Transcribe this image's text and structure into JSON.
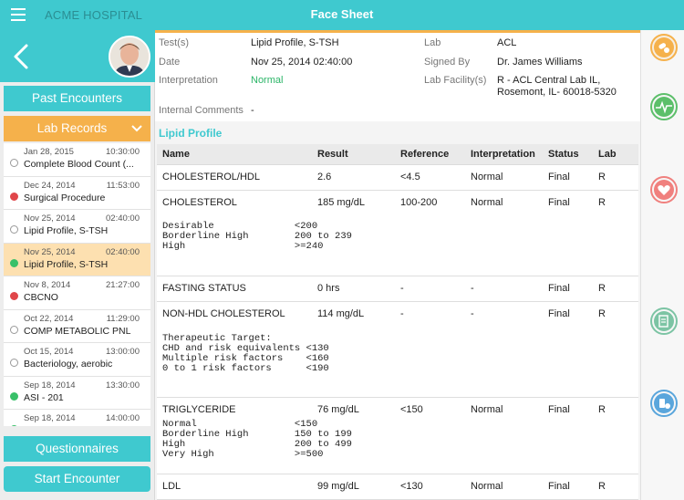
{
  "header": {
    "hospital": "ACME HOSPITAL",
    "title": "Face Sheet"
  },
  "sidebar": {
    "past_encounters": "Past Encounters",
    "lab_records": "Lab Records",
    "questionnaires": "Questionnaires",
    "start_encounter": "Start Encounter",
    "records": [
      {
        "date": "Jan 28, 2015",
        "time": "10:30:00",
        "name": "Complete Blood Count (...",
        "status": "none"
      },
      {
        "date": "Dec 24, 2014",
        "time": "11:53:00",
        "name": "Surgical Procedure",
        "status": "red"
      },
      {
        "date": "Nov 25, 2014",
        "time": "02:40:00",
        "name": "Lipid Profile, S-TSH",
        "status": "none"
      },
      {
        "date": "Nov 25, 2014",
        "time": "02:40:00",
        "name": "Lipid Profile, S-TSH",
        "status": "green"
      },
      {
        "date": "Nov 8, 2014",
        "time": "21:27:00",
        "name": "CBCNO",
        "status": "red"
      },
      {
        "date": "Oct 22, 2014",
        "time": "11:29:00",
        "name": "COMP METABOLIC PNL",
        "status": "none"
      },
      {
        "date": "Oct 15, 2014",
        "time": "13:00:00",
        "name": "Bacteriology, aerobic",
        "status": "none"
      },
      {
        "date": "Sep 18, 2014",
        "time": "13:30:00",
        "name": "ASI - 201",
        "status": "green"
      },
      {
        "date": "Sep 18, 2014",
        "time": "14:00:00",
        "name": "",
        "status": "green"
      }
    ]
  },
  "info": {
    "tests_label": "Test(s)",
    "tests_value": "Lipid Profile, S-TSH",
    "date_label": "Date",
    "date_value": "Nov 25, 2014 02:40:00",
    "interp_label": "Interpretation",
    "interp_value": "Normal",
    "lab_label": "Lab",
    "lab_value": "ACL",
    "signed_label": "Signed By",
    "signed_value": "Dr. James Williams",
    "facility_label": "Lab Facility(s)",
    "facility_line1": "R - ACL Central Lab IL,",
    "facility_line2": "Rosemont, IL- 60018-5320",
    "comments_label": "Internal Comments",
    "comments_value": "-"
  },
  "section_title": "Lipid Profile",
  "table": {
    "headers": {
      "name": "Name",
      "result": "Result",
      "reference": "Reference",
      "interpretation": "Interpretation",
      "status": "Status",
      "lab": "Lab"
    },
    "rows": [
      {
        "name": "CHOLESTEROL/HDL",
        "result": "2.6",
        "reference": "<4.5",
        "interpretation": "Normal",
        "status": "Final",
        "lab": "R",
        "note": ""
      },
      {
        "name": "CHOLESTEROL",
        "result": "185 mg/dL",
        "reference": "100-200",
        "interpretation": "Normal",
        "status": "Final",
        "lab": "R",
        "note": "Desirable              <200\nBorderline High        200 to 239\nHigh                   >=240"
      },
      {
        "name": "FASTING STATUS",
        "result": "0 hrs",
        "reference": "-",
        "interpretation": "-",
        "status": "Final",
        "lab": "R",
        "note": ""
      },
      {
        "name": "NON-HDL CHOLESTEROL",
        "result": "114 mg/dL",
        "reference": "-",
        "interpretation": "-",
        "status": "Final",
        "lab": "R",
        "note": "Therapeutic Target:\nCHD and risk equivalents <130\nMultiple risk factors    <160\n0 to 1 risk factors      <190"
      },
      {
        "name": "TRIGLYCERIDE",
        "result": "76 mg/dL",
        "reference": "<150",
        "interpretation": "Normal",
        "status": "Final",
        "lab": "R",
        "note": "Normal                 <150\nBorderline High        150 to 199\nHigh                   200 to 499\nVery High              >=500"
      },
      {
        "name": "LDL",
        "result": "99 mg/dL",
        "reference": "<130",
        "interpretation": "Normal",
        "status": "Final",
        "lab": "R",
        "note": ""
      }
    ]
  },
  "rail": {
    "icons": [
      "pills-icon",
      "vitals-icon",
      "heart-icon",
      "notes-icon",
      "medication-icon"
    ],
    "colors": [
      "#f5b14b",
      "#5cbf6a",
      "#f0807e",
      "#7cc4a4",
      "#5aa6dc"
    ]
  },
  "colors": {
    "accent": "#3fc9cf",
    "orange": "#f5b14b",
    "normal": "#2cb568"
  }
}
